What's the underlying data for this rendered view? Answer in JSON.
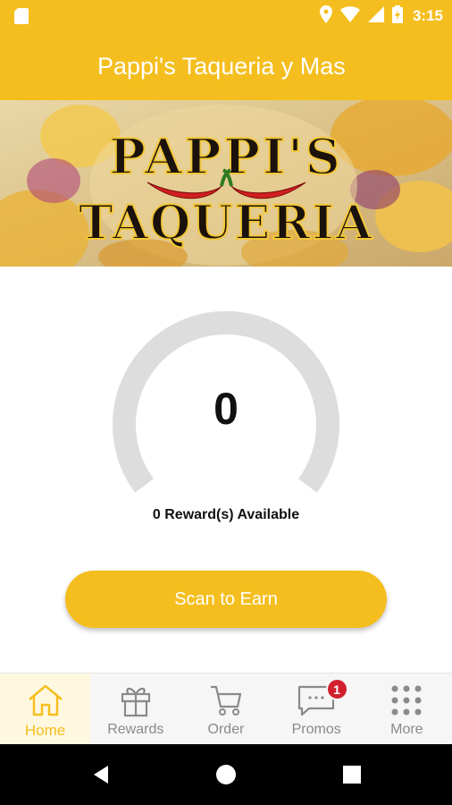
{
  "status_bar": {
    "time": "3:15",
    "icons": [
      "sd-card-icon",
      "location-icon",
      "wifi-icon",
      "signal-icon",
      "battery-icon"
    ]
  },
  "app_bar": {
    "title": "Pappi's Taqueria y Mas"
  },
  "banner": {
    "logo_line1": "PAPPI'S",
    "logo_line2": "TAQUERIA"
  },
  "rewards": {
    "points": "0",
    "available_text": "0 Reward(s) Available"
  },
  "scan_button": {
    "label": "Scan to Earn"
  },
  "bottom_nav": {
    "items": [
      {
        "label": "Home",
        "icon": "home-icon",
        "active": true
      },
      {
        "label": "Rewards",
        "icon": "gift-icon"
      },
      {
        "label": "Order",
        "icon": "cart-icon"
      },
      {
        "label": "Promos",
        "icon": "chat-icon",
        "badge": "1"
      },
      {
        "label": "More",
        "icon": "grid-icon"
      }
    ]
  },
  "colors": {
    "brand": "#F5BE1F",
    "badge": "#d3202e",
    "gauge_track": "#dddddd"
  },
  "android_nav": {
    "icons": [
      "back-icon",
      "home-circle-icon",
      "recents-icon"
    ]
  }
}
